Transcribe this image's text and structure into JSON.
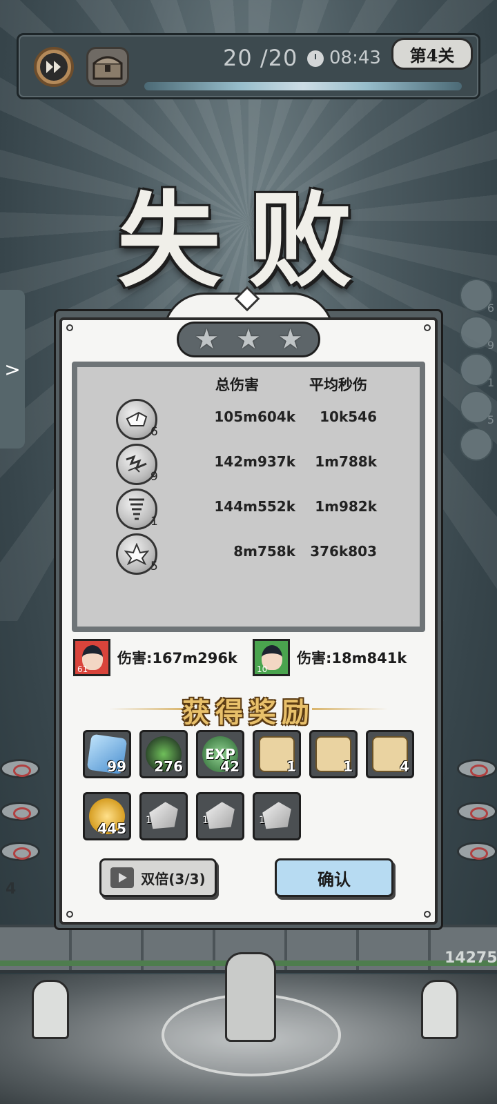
{
  "topbar": {
    "wave": "20 /20",
    "time": "08:43",
    "stage": "第4关",
    "icons": [
      "fast-forward-icon",
      "chest-icon",
      "clock-icon"
    ]
  },
  "result_title": "失败",
  "stars": 3,
  "side_tab_arrow": ">",
  "cooldowns": [
    "6",
    "9",
    "1",
    "5",
    ""
  ],
  "stats": {
    "header_total": "总伤害",
    "header_dps": "平均秒伤",
    "rows": [
      {
        "icon": "rock-skill-icon",
        "level": "6",
        "total": "105m604k",
        "dps": "10k546"
      },
      {
        "icon": "lightning-skill-icon",
        "level": "9",
        "total": "142m937k",
        "dps": "1m788k"
      },
      {
        "icon": "tornado-skill-icon",
        "level": "1",
        "total": "144m552k",
        "dps": "1m982k"
      },
      {
        "icon": "crystal-skill-icon",
        "level": "5",
        "total": "8m758k",
        "dps": "376k803"
      }
    ]
  },
  "heroes": [
    {
      "level": "61",
      "damage": "伤害:167m296k",
      "frame_color": "#d9443b"
    },
    {
      "level": "10",
      "damage": "伤害:18m841k",
      "frame_color": "#4aa44e"
    }
  ],
  "reward_title": "获得奖励",
  "rewards": [
    {
      "icon": "blue-crystal-icon",
      "qty": "99",
      "color": "#78b7e6"
    },
    {
      "icon": "green-leaf-icon",
      "qty": "276",
      "color": "#3f5a3a"
    },
    {
      "icon": "exp-icon",
      "qty": "42",
      "label": "EXP",
      "color": "#4e8a54"
    },
    {
      "icon": "scroll-necklace-icon",
      "qty": "1",
      "color": "#e9d3a3"
    },
    {
      "icon": "scroll-hat-icon",
      "qty": "1",
      "color": "#e9d3a3"
    },
    {
      "icon": "scroll-boot-icon",
      "qty": "4",
      "color": "#e9d3a3"
    },
    {
      "icon": "gold-coin-icon",
      "qty": "445",
      "color": "#e0a92a"
    },
    {
      "icon": "ore-icon",
      "qty": "1",
      "color": "#dedede"
    },
    {
      "icon": "ore-icon",
      "qty": "1",
      "color": "#dedede"
    },
    {
      "icon": "ore-icon",
      "qty": "1",
      "color": "#dedede"
    }
  ],
  "buttons": {
    "double": "双倍(3/3)",
    "confirm": "确认"
  },
  "battlefield": {
    "boss_hp": "14275",
    "left_count": "4"
  }
}
